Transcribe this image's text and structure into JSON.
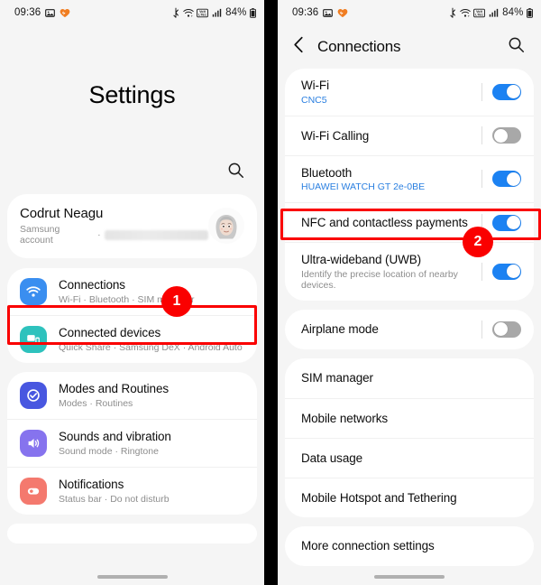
{
  "statusbar": {
    "time": "09:36",
    "battery": "84%",
    "left_icons": [
      "gallery-icon",
      "heart-icon"
    ],
    "right_icons": [
      "bluetooth-icon",
      "wifi-calling-icon",
      "volte-icon",
      "signal-icon",
      "battery-icon"
    ]
  },
  "left_panel": {
    "title": "Settings",
    "search_icon": "search-icon",
    "account": {
      "name": "Codrut Neagu",
      "subtitle": "Samsung account",
      "separator": "·",
      "email_redacted": ""
    },
    "items": [
      {
        "title": "Connections",
        "subtitle": "Wi-Fi · Bluetooth · SIM manager",
        "icon": "wifi-icon",
        "icon_color": "#3a8ef0"
      },
      {
        "title": "Connected devices",
        "subtitle": "Quick Share · Samsung DeX · Android Auto",
        "icon": "connected-devices-icon",
        "icon_color": "#2ec2bd"
      },
      {
        "title": "Modes and Routines",
        "subtitle": "Modes · Routines",
        "icon": "modes-routines-icon",
        "icon_color": "#4857e0"
      },
      {
        "title": "Sounds and vibration",
        "subtitle": "Sound mode · Ringtone",
        "icon": "sound-icon",
        "icon_color": "#8673ee"
      },
      {
        "title": "Notifications",
        "subtitle": "Status bar · Do not disturb",
        "icon": "notifications-icon",
        "icon_color": "#f4796e"
      }
    ]
  },
  "right_panel": {
    "back_icon": "back-chevron-icon",
    "title": "Connections",
    "search_icon": "search-icon",
    "group1": [
      {
        "title": "Wi-Fi",
        "subtitle": "CNC5",
        "subtitle_style": "blue",
        "toggle": "on"
      },
      {
        "title": "Wi-Fi Calling",
        "subtitle": "",
        "subtitle_style": "none",
        "toggle": "off"
      },
      {
        "title": "Bluetooth",
        "subtitle": "HUAWEI WATCH GT 2e-0BE",
        "subtitle_style": "blue",
        "toggle": "on"
      },
      {
        "title": "NFC and contactless payments",
        "subtitle": "",
        "subtitle_style": "none",
        "toggle": "on"
      },
      {
        "title": "Ultra-wideband (UWB)",
        "subtitle": "Identify the precise location of nearby devices.",
        "subtitle_style": "gray",
        "toggle": "on"
      }
    ],
    "group2": [
      {
        "title": "Airplane mode",
        "toggle": "off"
      }
    ],
    "group3": [
      {
        "title": "SIM manager"
      },
      {
        "title": "Mobile networks"
      },
      {
        "title": "Data usage"
      },
      {
        "title": "Mobile Hotspot and Tethering"
      }
    ],
    "group4": [
      {
        "title": "More connection settings"
      }
    ]
  },
  "annotations": {
    "accent_color": "#fa0000",
    "badges": [
      {
        "label": "1",
        "target": "Connections row in Settings"
      },
      {
        "label": "2",
        "target": "NFC and contactless payments row"
      }
    ]
  }
}
